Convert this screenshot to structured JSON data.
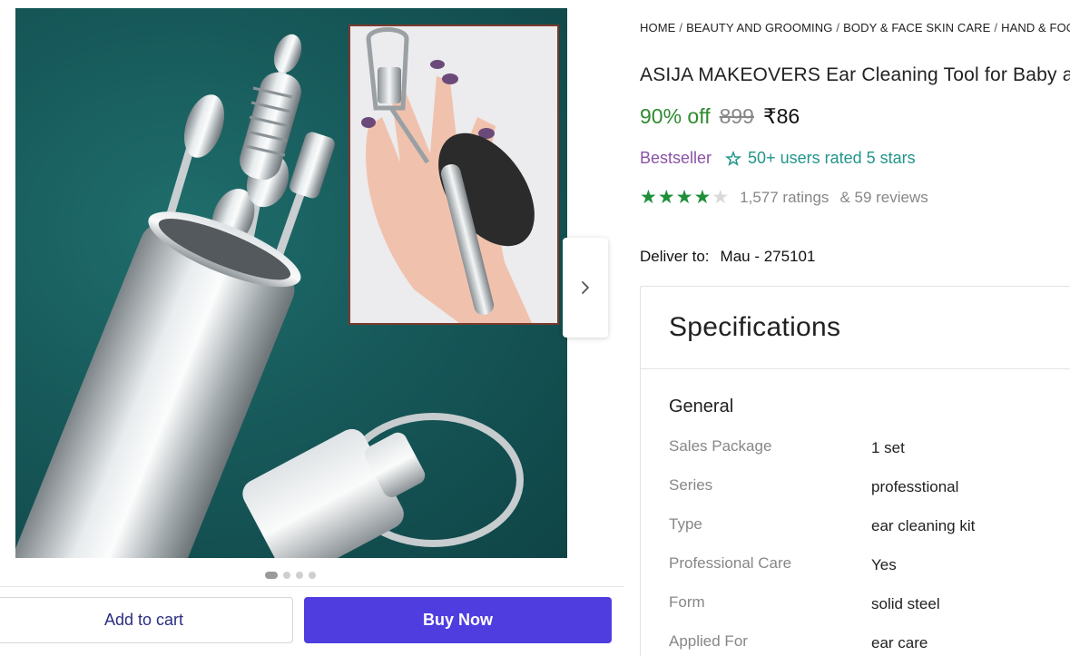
{
  "breadcrumb": [
    "HOME",
    "BEAUTY AND GROOMING",
    "BODY & FACE SKIN CARE",
    "HAND & FOOT CARE"
  ],
  "product": {
    "title": "ASIJA MAKEOVERS Ear Cleaning Tool for Baby and Adults",
    "discount": "90% off",
    "mrp": "899",
    "price": "₹86",
    "bestseller": "Bestseller",
    "users_rated": "50+ users rated 5 stars",
    "rating_value": 4,
    "rating_max": 5,
    "ratings_count": "1,577 ratings",
    "reviews_count": "& 59 reviews"
  },
  "delivery": {
    "label": "Deliver to:",
    "location": "Mau - 275101"
  },
  "gallery": {
    "image_count": 4,
    "active_index": 0
  },
  "actions": {
    "add_to_cart": "Add to cart",
    "buy_now": "Buy Now"
  },
  "specifications": {
    "title": "Specifications",
    "group": "General",
    "rows": [
      {
        "label": "Sales Package",
        "value": "1 set"
      },
      {
        "label": "Series",
        "value": "professtional"
      },
      {
        "label": "Type",
        "value": "ear cleaning kit"
      },
      {
        "label": "Professional Care",
        "value": "Yes"
      },
      {
        "label": "Form",
        "value": "solid steel"
      },
      {
        "label": "Applied For",
        "value": "ear care"
      }
    ]
  },
  "colors": {
    "discount": "#2e8b2e",
    "bestseller": "#8a52a5",
    "users_rated": "#22958a",
    "star": "#1e8f3a",
    "buy_now": "#4f3de0",
    "add_to_cart_text": "#2a2e7f"
  },
  "icons": {
    "next": "chevron-right-icon",
    "badge": "star-badge-icon"
  }
}
